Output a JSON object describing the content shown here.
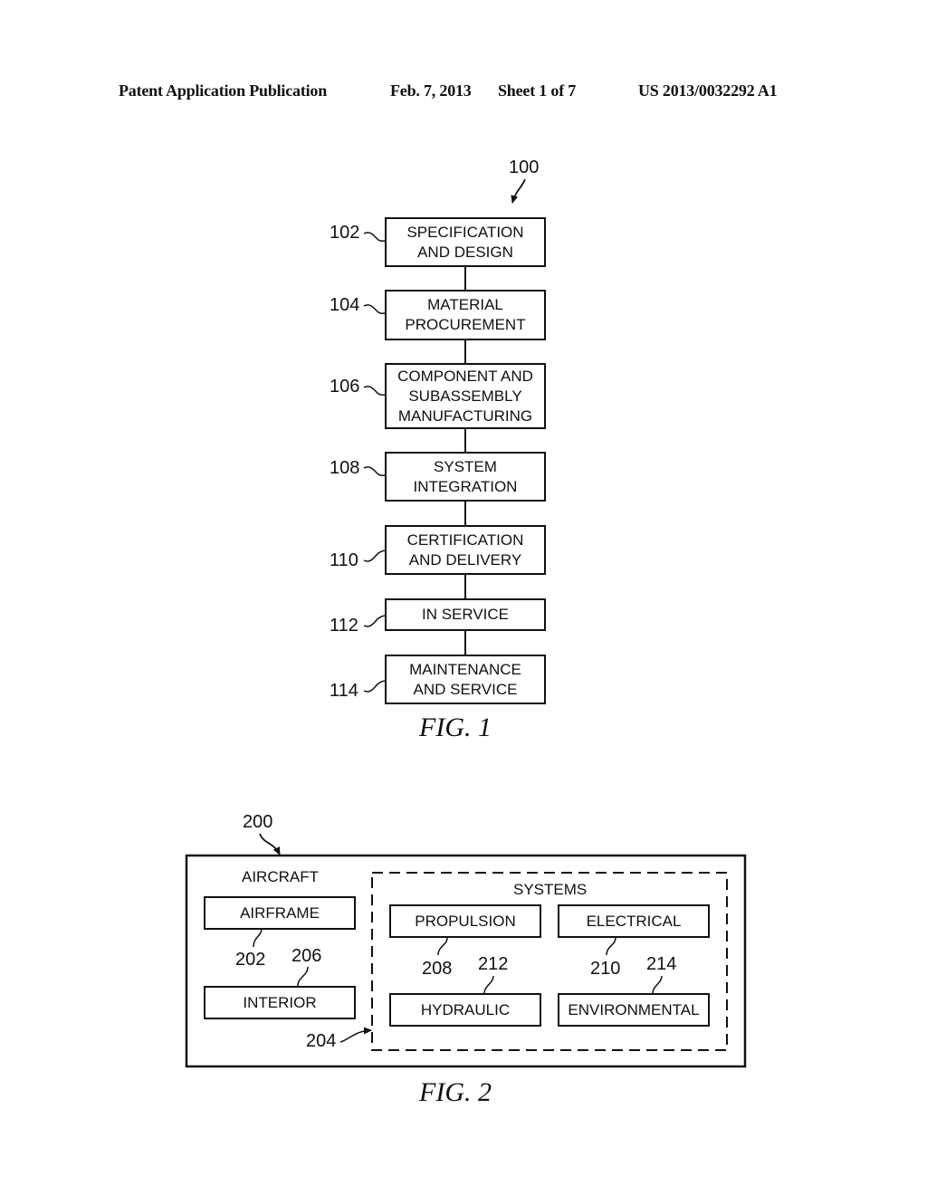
{
  "header": {
    "publication": "Patent Application Publication",
    "date": "Feb. 7, 2013",
    "sheet": "Sheet 1 of 7",
    "number": "US 2013/0032292 A1"
  },
  "fig1": {
    "caption": "FIG. 1",
    "ref": "100",
    "steps": [
      {
        "ref": "102",
        "lines": [
          "SPECIFICATION",
          "AND DESIGN"
        ]
      },
      {
        "ref": "104",
        "lines": [
          "MATERIAL",
          "PROCUREMENT"
        ]
      },
      {
        "ref": "106",
        "lines": [
          "COMPONENT AND",
          "SUBASSEMBLY",
          "MANUFACTURING"
        ]
      },
      {
        "ref": "108",
        "lines": [
          "SYSTEM",
          "INTEGRATION"
        ]
      },
      {
        "ref": "110",
        "lines": [
          "CERTIFICATION",
          "AND DELIVERY"
        ]
      },
      {
        "ref": "112",
        "lines": [
          "IN SERVICE"
        ]
      },
      {
        "ref": "114",
        "lines": [
          "MAINTENANCE",
          "AND SERVICE"
        ]
      }
    ]
  },
  "fig2": {
    "caption": "FIG. 2",
    "ref": "200",
    "aircraft_label": "AIRCRAFT",
    "airframe": {
      "label": "AIRFRAME",
      "ref": "202"
    },
    "interior": {
      "label": "INTERIOR",
      "ref": "206"
    },
    "systems": {
      "label": "SYSTEMS",
      "ref": "204",
      "propulsion": {
        "label": "PROPULSION",
        "ref": "208"
      },
      "electrical": {
        "label": "ELECTRICAL",
        "ref": "210"
      },
      "hydraulic": {
        "label": "HYDRAULIC",
        "ref": "212"
      },
      "environmental": {
        "label": "ENVIRONMENTAL",
        "ref": "214"
      }
    }
  }
}
